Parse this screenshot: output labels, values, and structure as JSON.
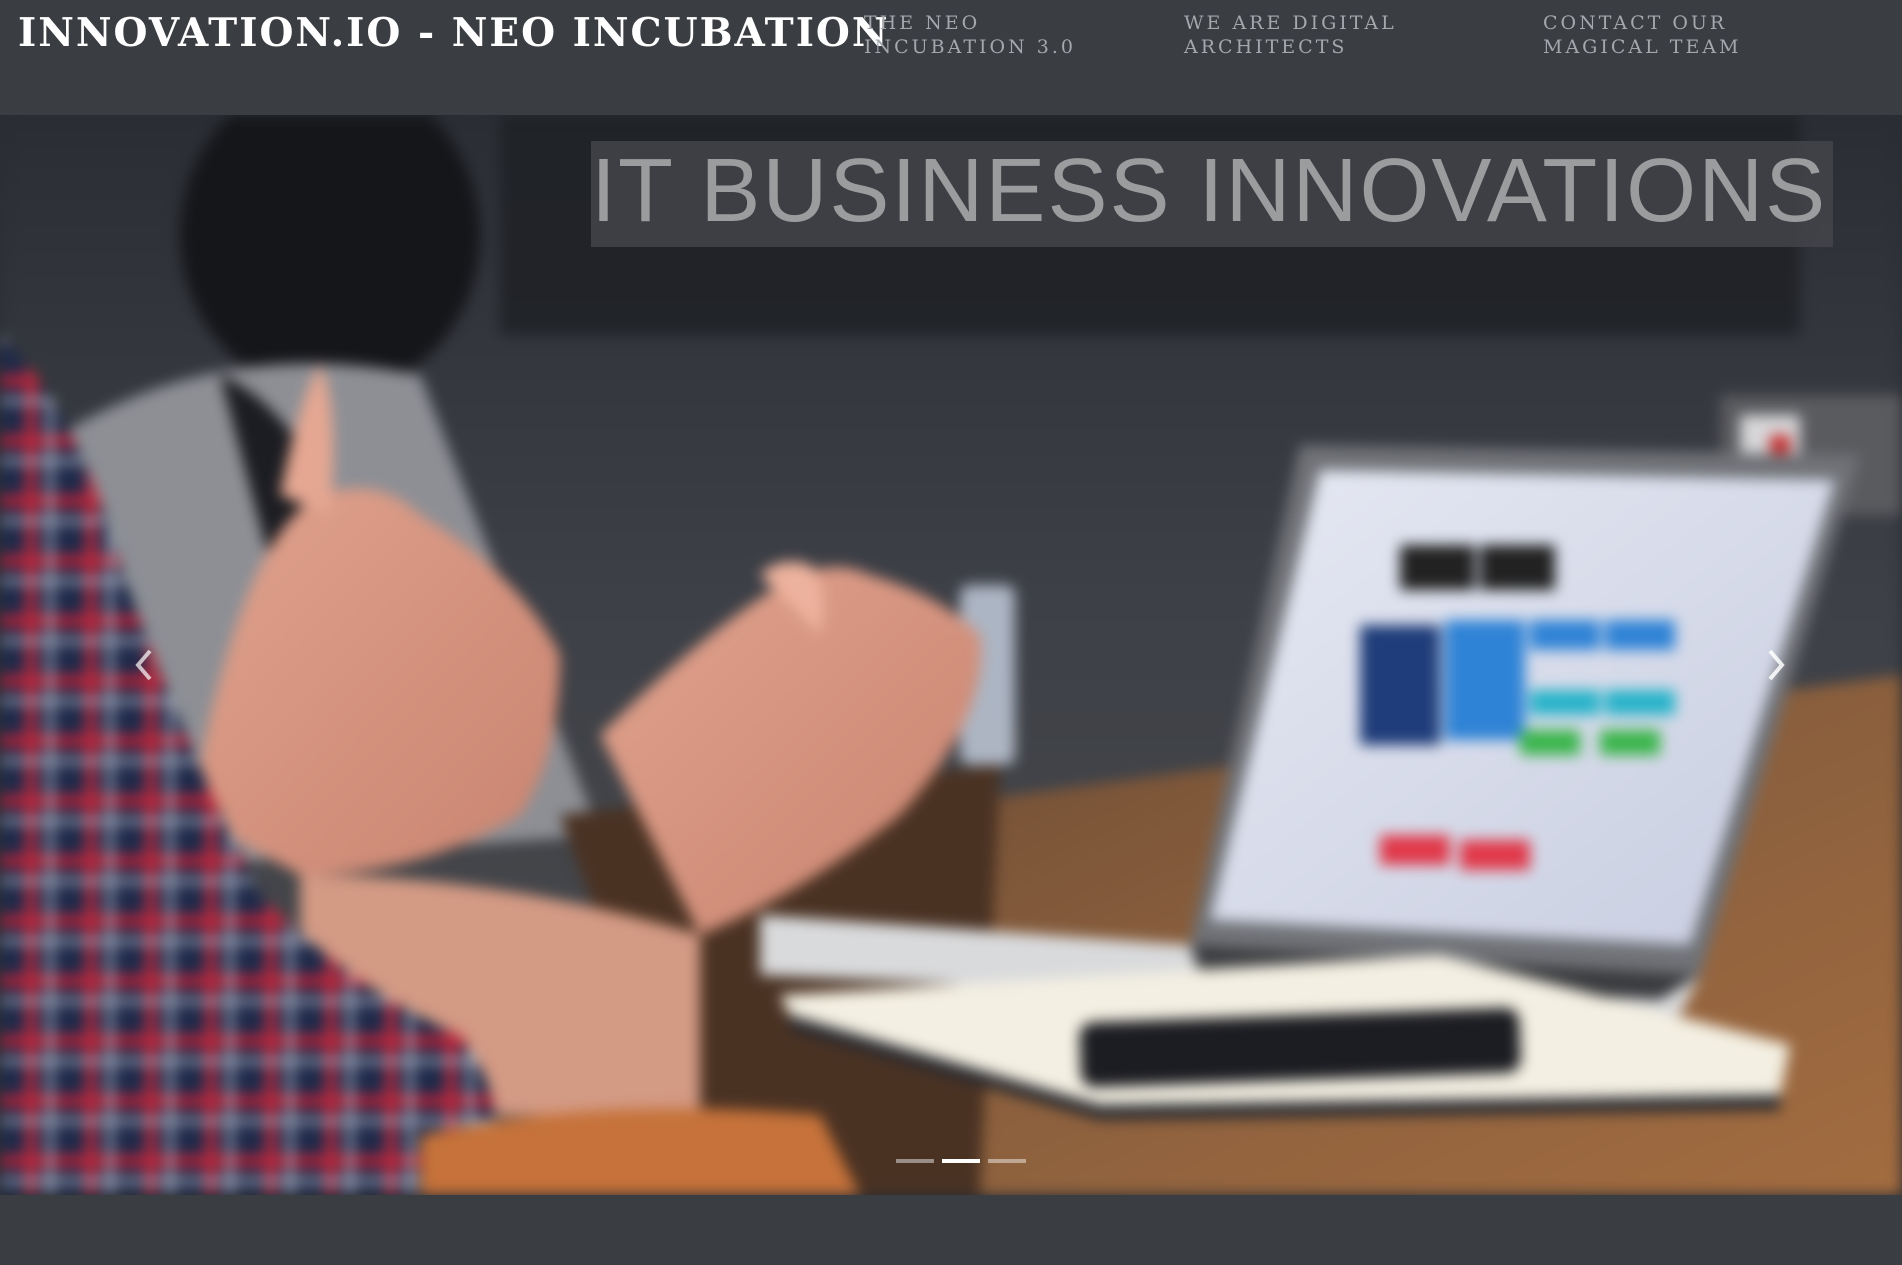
{
  "header": {
    "brand": "INNOVATION.IO - NEO INCUBATION",
    "nav": [
      {
        "line1": "THE NEO",
        "line2": "INCUBATION 3.0"
      },
      {
        "line1": "WE ARE DIGITAL",
        "line2": "ARCHITECTS"
      },
      {
        "line1": "CONTACT OUR",
        "line2": "MAGICAL TEAM"
      }
    ]
  },
  "hero": {
    "title": "IT BUSINESS INNOVATIONS",
    "prev_icon": "chevron-left-icon",
    "next_icon": "chevron-right-icon",
    "slide_count": 3,
    "active_slide": 2
  },
  "colors": {
    "header_bg": "#3a3d42",
    "brand_text": "#ffffff",
    "nav_text": "#a4a8ad",
    "hero_title_text": "#9b9c9e"
  }
}
